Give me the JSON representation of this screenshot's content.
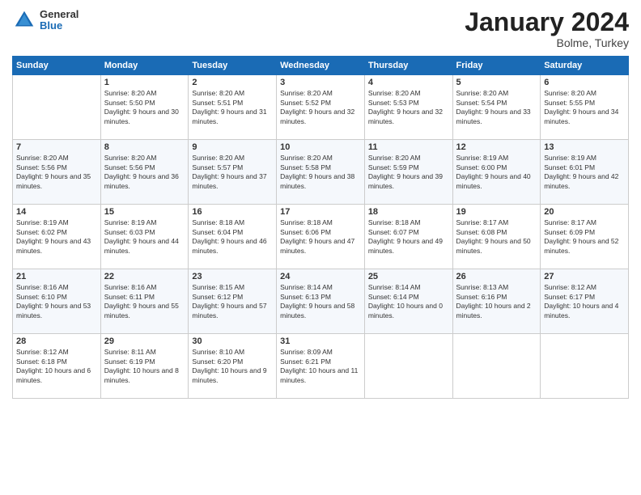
{
  "logo": {
    "general": "General",
    "blue": "Blue"
  },
  "header": {
    "month": "January 2024",
    "location": "Bolme, Turkey"
  },
  "columns": [
    "Sunday",
    "Monday",
    "Tuesday",
    "Wednesday",
    "Thursday",
    "Friday",
    "Saturday"
  ],
  "weeks": [
    [
      {
        "day": "",
        "sunrise": "",
        "sunset": "",
        "daylight": ""
      },
      {
        "day": "1",
        "sunrise": "Sunrise: 8:20 AM",
        "sunset": "Sunset: 5:50 PM",
        "daylight": "Daylight: 9 hours and 30 minutes."
      },
      {
        "day": "2",
        "sunrise": "Sunrise: 8:20 AM",
        "sunset": "Sunset: 5:51 PM",
        "daylight": "Daylight: 9 hours and 31 minutes."
      },
      {
        "day": "3",
        "sunrise": "Sunrise: 8:20 AM",
        "sunset": "Sunset: 5:52 PM",
        "daylight": "Daylight: 9 hours and 32 minutes."
      },
      {
        "day": "4",
        "sunrise": "Sunrise: 8:20 AM",
        "sunset": "Sunset: 5:53 PM",
        "daylight": "Daylight: 9 hours and 32 minutes."
      },
      {
        "day": "5",
        "sunrise": "Sunrise: 8:20 AM",
        "sunset": "Sunset: 5:54 PM",
        "daylight": "Daylight: 9 hours and 33 minutes."
      },
      {
        "day": "6",
        "sunrise": "Sunrise: 8:20 AM",
        "sunset": "Sunset: 5:55 PM",
        "daylight": "Daylight: 9 hours and 34 minutes."
      }
    ],
    [
      {
        "day": "7",
        "sunrise": "Sunrise: 8:20 AM",
        "sunset": "Sunset: 5:56 PM",
        "daylight": "Daylight: 9 hours and 35 minutes."
      },
      {
        "day": "8",
        "sunrise": "Sunrise: 8:20 AM",
        "sunset": "Sunset: 5:56 PM",
        "daylight": "Daylight: 9 hours and 36 minutes."
      },
      {
        "day": "9",
        "sunrise": "Sunrise: 8:20 AM",
        "sunset": "Sunset: 5:57 PM",
        "daylight": "Daylight: 9 hours and 37 minutes."
      },
      {
        "day": "10",
        "sunrise": "Sunrise: 8:20 AM",
        "sunset": "Sunset: 5:58 PM",
        "daylight": "Daylight: 9 hours and 38 minutes."
      },
      {
        "day": "11",
        "sunrise": "Sunrise: 8:20 AM",
        "sunset": "Sunset: 5:59 PM",
        "daylight": "Daylight: 9 hours and 39 minutes."
      },
      {
        "day": "12",
        "sunrise": "Sunrise: 8:19 AM",
        "sunset": "Sunset: 6:00 PM",
        "daylight": "Daylight: 9 hours and 40 minutes."
      },
      {
        "day": "13",
        "sunrise": "Sunrise: 8:19 AM",
        "sunset": "Sunset: 6:01 PM",
        "daylight": "Daylight: 9 hours and 42 minutes."
      }
    ],
    [
      {
        "day": "14",
        "sunrise": "Sunrise: 8:19 AM",
        "sunset": "Sunset: 6:02 PM",
        "daylight": "Daylight: 9 hours and 43 minutes."
      },
      {
        "day": "15",
        "sunrise": "Sunrise: 8:19 AM",
        "sunset": "Sunset: 6:03 PM",
        "daylight": "Daylight: 9 hours and 44 minutes."
      },
      {
        "day": "16",
        "sunrise": "Sunrise: 8:18 AM",
        "sunset": "Sunset: 6:04 PM",
        "daylight": "Daylight: 9 hours and 46 minutes."
      },
      {
        "day": "17",
        "sunrise": "Sunrise: 8:18 AM",
        "sunset": "Sunset: 6:06 PM",
        "daylight": "Daylight: 9 hours and 47 minutes."
      },
      {
        "day": "18",
        "sunrise": "Sunrise: 8:18 AM",
        "sunset": "Sunset: 6:07 PM",
        "daylight": "Daylight: 9 hours and 49 minutes."
      },
      {
        "day": "19",
        "sunrise": "Sunrise: 8:17 AM",
        "sunset": "Sunset: 6:08 PM",
        "daylight": "Daylight: 9 hours and 50 minutes."
      },
      {
        "day": "20",
        "sunrise": "Sunrise: 8:17 AM",
        "sunset": "Sunset: 6:09 PM",
        "daylight": "Daylight: 9 hours and 52 minutes."
      }
    ],
    [
      {
        "day": "21",
        "sunrise": "Sunrise: 8:16 AM",
        "sunset": "Sunset: 6:10 PM",
        "daylight": "Daylight: 9 hours and 53 minutes."
      },
      {
        "day": "22",
        "sunrise": "Sunrise: 8:16 AM",
        "sunset": "Sunset: 6:11 PM",
        "daylight": "Daylight: 9 hours and 55 minutes."
      },
      {
        "day": "23",
        "sunrise": "Sunrise: 8:15 AM",
        "sunset": "Sunset: 6:12 PM",
        "daylight": "Daylight: 9 hours and 57 minutes."
      },
      {
        "day": "24",
        "sunrise": "Sunrise: 8:14 AM",
        "sunset": "Sunset: 6:13 PM",
        "daylight": "Daylight: 9 hours and 58 minutes."
      },
      {
        "day": "25",
        "sunrise": "Sunrise: 8:14 AM",
        "sunset": "Sunset: 6:14 PM",
        "daylight": "Daylight: 10 hours and 0 minutes."
      },
      {
        "day": "26",
        "sunrise": "Sunrise: 8:13 AM",
        "sunset": "Sunset: 6:16 PM",
        "daylight": "Daylight: 10 hours and 2 minutes."
      },
      {
        "day": "27",
        "sunrise": "Sunrise: 8:12 AM",
        "sunset": "Sunset: 6:17 PM",
        "daylight": "Daylight: 10 hours and 4 minutes."
      }
    ],
    [
      {
        "day": "28",
        "sunrise": "Sunrise: 8:12 AM",
        "sunset": "Sunset: 6:18 PM",
        "daylight": "Daylight: 10 hours and 6 minutes."
      },
      {
        "day": "29",
        "sunrise": "Sunrise: 8:11 AM",
        "sunset": "Sunset: 6:19 PM",
        "daylight": "Daylight: 10 hours and 8 minutes."
      },
      {
        "day": "30",
        "sunrise": "Sunrise: 8:10 AM",
        "sunset": "Sunset: 6:20 PM",
        "daylight": "Daylight: 10 hours and 9 minutes."
      },
      {
        "day": "31",
        "sunrise": "Sunrise: 8:09 AM",
        "sunset": "Sunset: 6:21 PM",
        "daylight": "Daylight: 10 hours and 11 minutes."
      },
      {
        "day": "",
        "sunrise": "",
        "sunset": "",
        "daylight": ""
      },
      {
        "day": "",
        "sunrise": "",
        "sunset": "",
        "daylight": ""
      },
      {
        "day": "",
        "sunrise": "",
        "sunset": "",
        "daylight": ""
      }
    ]
  ]
}
